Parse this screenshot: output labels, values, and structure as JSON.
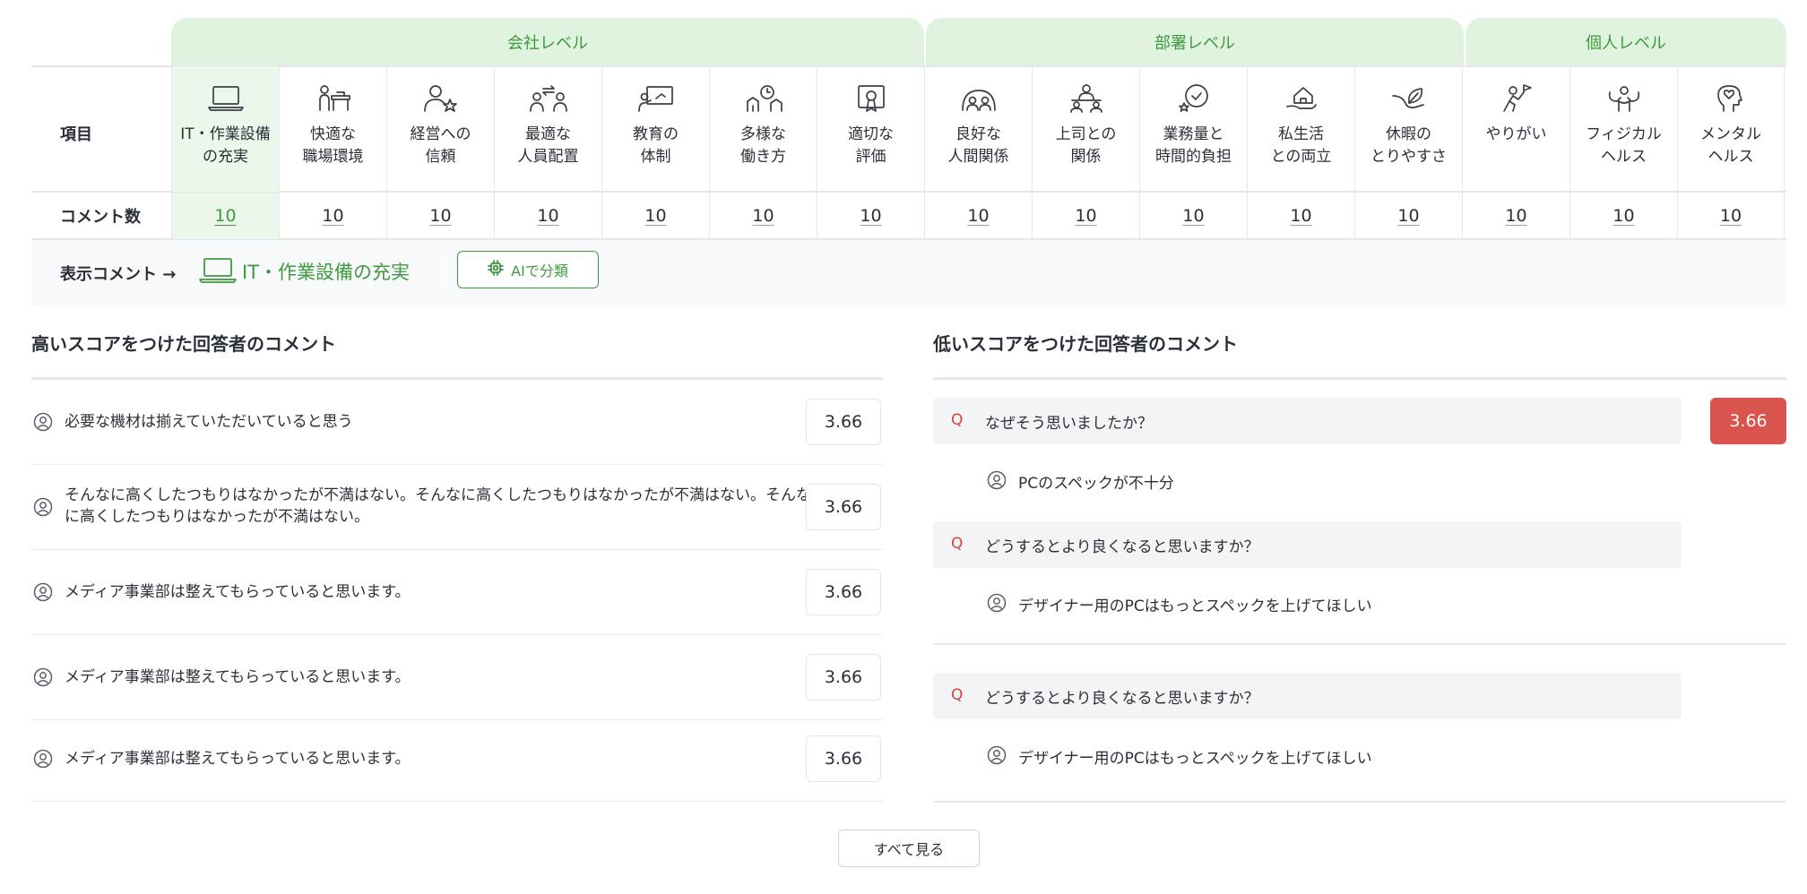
{
  "table": {
    "levels": [
      {
        "label": "会社レベル"
      },
      {
        "label": "部署レベル"
      },
      {
        "label": "個人レベル"
      }
    ],
    "row_label_item": "項目",
    "row_label_count": "コメント数",
    "categories": [
      {
        "label": "IT・作業設備\nの充実",
        "icon": "laptop-icon",
        "count": "10",
        "selected": true
      },
      {
        "label": "快適な\n職場環境",
        "icon": "office-desk-icon",
        "count": "10"
      },
      {
        "label": "経営への\n信頼",
        "icon": "person-star-icon",
        "count": "10"
      },
      {
        "label": "最適な\n人員配置",
        "icon": "people-swap-icon",
        "count": "10"
      },
      {
        "label": "教育の\n体制",
        "icon": "teaching-board-icon",
        "count": "10"
      },
      {
        "label": "多様な\n働き方",
        "icon": "person-clock-icon",
        "count": "10"
      },
      {
        "label": "適切な\n評価",
        "icon": "certificate-icon",
        "count": "10"
      },
      {
        "label": "良好な\n人間関係",
        "icon": "group-icon",
        "count": "10"
      },
      {
        "label": "上司との\n関係",
        "icon": "boss-meeting-icon",
        "count": "10"
      },
      {
        "label": "業務量と\n時間的負担",
        "icon": "clock-star-icon",
        "count": "10"
      },
      {
        "label": "私生活\nとの両立",
        "icon": "home-hand-icon",
        "count": "10"
      },
      {
        "label": "休暇の\nとりやすさ",
        "icon": "leaf-hand-icon",
        "count": "10"
      },
      {
        "label": "やりがい",
        "icon": "person-flag-icon",
        "count": "10"
      },
      {
        "label": "フィジカル\nヘルス",
        "icon": "muscle-icon",
        "count": "10"
      },
      {
        "label": "メンタル\nヘルス",
        "icon": "heart-head-icon",
        "count": "10"
      }
    ]
  },
  "display": {
    "label": "表示コメント →",
    "value": "IT・作業設備の充実",
    "icon": "laptop-icon",
    "ai_button_label": "AIで分類",
    "ai_button_icon": "chip-icon"
  },
  "high_section": {
    "title": "高いスコアをつけた回答者のコメント",
    "comments": [
      {
        "text": "必要な機材は揃えていただいていると思う",
        "score": "3.66"
      },
      {
        "text": "そんなに高くしたつもりはなかったが不満はない。そんなに高くしたつもりはなかったが不満はない。そんなに高くしたつもりはなかったが不満はない。",
        "score": "3.66"
      },
      {
        "text": "メディア事業部は整えてもらっていると思います。",
        "score": "3.66"
      },
      {
        "text": "メディア事業部は整えてもらっていると思います。",
        "score": "3.66"
      },
      {
        "text": "メディア事業部は整えてもらっていると思います。",
        "score": "3.66"
      }
    ]
  },
  "low_section": {
    "title": "低いスコアをつけた回答者のコメント",
    "score": "3.66",
    "q_mark": "Q",
    "qa": [
      {
        "question": "なぜそう思いましたか？",
        "answer": "PCのスペックが不十分"
      },
      {
        "question": "どうするとより良くなると思いますか？",
        "answer": "デザイナー用のPCはもっとスペックを上げてほしい"
      },
      {
        "question": "どうするとより良くなると思いますか？",
        "answer": "デザイナー用のPCはもっとスペックを上げてほしい"
      }
    ]
  },
  "see_all_label": "すべて見る",
  "colors": {
    "accent_green": "#3f9a3f",
    "level_band": "#dff3df",
    "selected_bg": "#eaf7ea",
    "low_score_red": "#d9534f",
    "q_red": "#d7433f"
  }
}
